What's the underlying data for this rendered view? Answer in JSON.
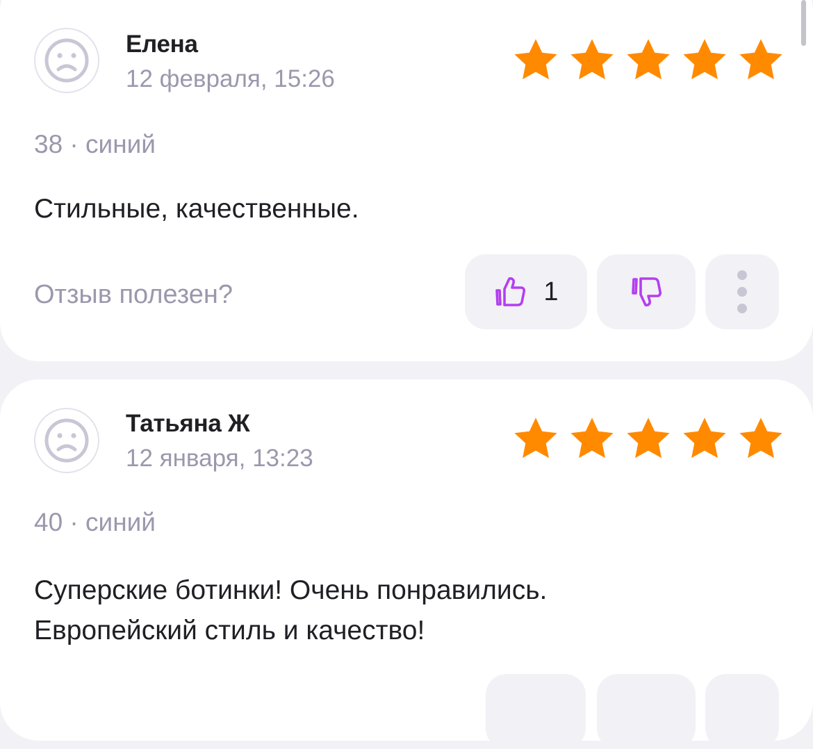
{
  "icons": {
    "avatar": "sad-face-icon",
    "star": "star-icon",
    "like": "thumbs-up-icon",
    "dislike": "thumbs-down-icon",
    "more": "more-vertical-icon"
  },
  "colors": {
    "star": "#ff8a00",
    "accent": "#b43ef0",
    "muted": "#9b98ad",
    "text": "#1f1f24",
    "background": "#f2f1f6",
    "card": "#ffffff"
  },
  "reviews": [
    {
      "author": "Елена",
      "date": "12 февраля, 15:26",
      "rating": 5,
      "variant": "38 · синий",
      "text_lines": [
        "Стильные, качественные."
      ],
      "helpful_label": "Отзыв полезен?",
      "likes": "1"
    },
    {
      "author": "Татьяна Ж",
      "date": "12 января, 13:23",
      "rating": 5,
      "variant": "40 · синий",
      "text_lines": [
        "Суперские ботинки! Очень понравились.",
        "Европейский стиль и качество!"
      ]
    }
  ]
}
